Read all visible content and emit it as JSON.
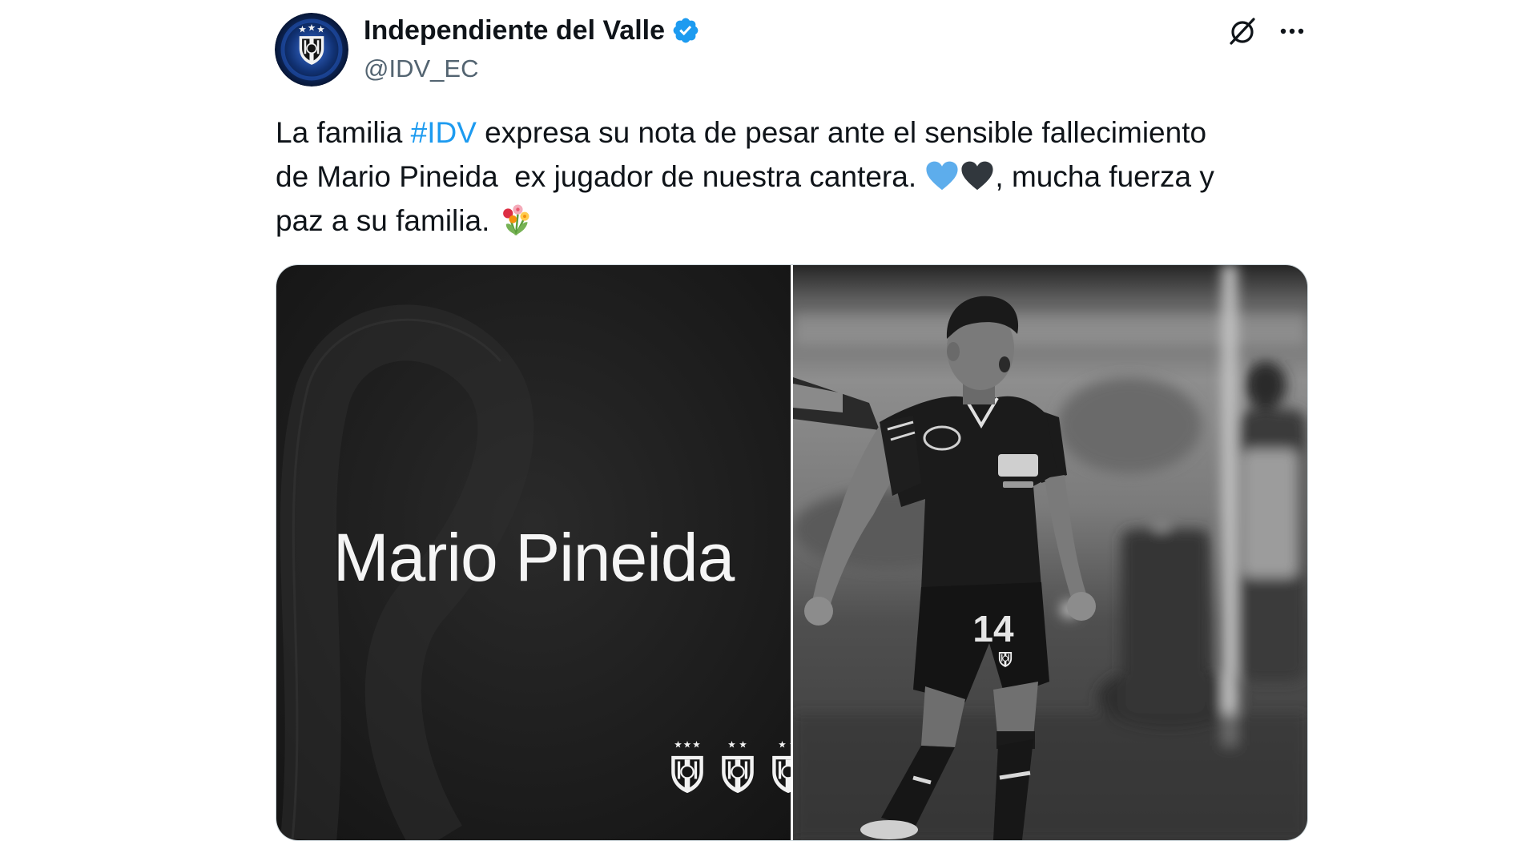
{
  "colors": {
    "text": "#0F1419",
    "secondary": "#536471",
    "link": "#1D9BF0",
    "verified": "#1D9BF0"
  },
  "tweet": {
    "author": {
      "name": "Independiente del Valle",
      "handle": "@IDV_EC",
      "verified": true,
      "avatar_icon": "club-crest-avatar-icon",
      "verified_icon": "verified-badge-icon"
    },
    "actions": {
      "grok": "grok-icon",
      "more": "more-options-icon"
    },
    "text": {
      "line1_start": "La familia ",
      "hashtag": "#IDV",
      "line1_end": " expresa su nota de pesar ante el sensible fallecimiento",
      "line2_start": "de Mario Pineida  ex jugador de nuestra cantera. ",
      "line2_emojis": [
        "blue-heart-icon",
        "black-heart-icon"
      ],
      "line2_end": ", mucha fuerza y",
      "line3_start": "paz a su familia. ",
      "line3_emojis": [
        "bouquet-icon"
      ]
    },
    "media": {
      "left": {
        "name_text": "Mario Pineida",
        "crest_icons": [
          "club-crest-icon",
          "club-crest-icon",
          "club-crest-icon"
        ]
      },
      "right": {
        "jersey_number": "14"
      }
    }
  }
}
